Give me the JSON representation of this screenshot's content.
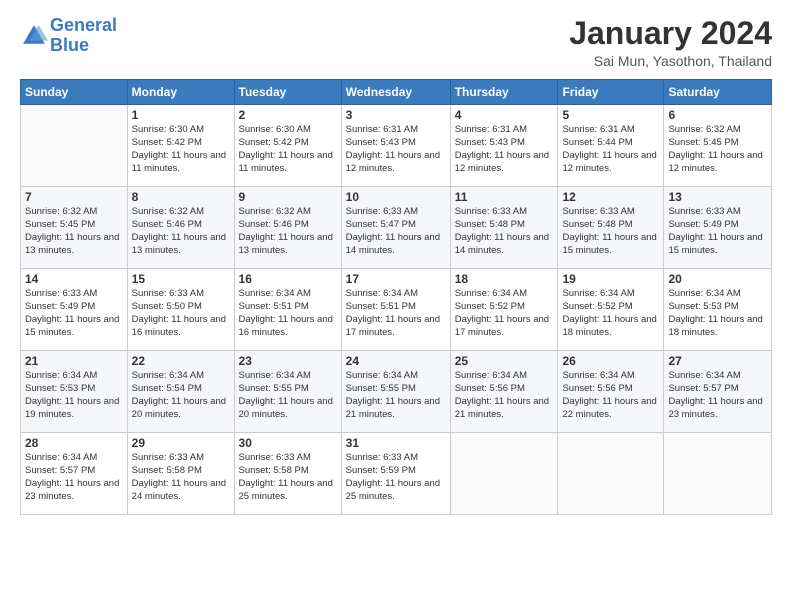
{
  "header": {
    "logo_line1": "General",
    "logo_line2": "Blue",
    "month": "January 2024",
    "location": "Sai Mun, Yasothon, Thailand"
  },
  "days_of_week": [
    "Sunday",
    "Monday",
    "Tuesday",
    "Wednesday",
    "Thursday",
    "Friday",
    "Saturday"
  ],
  "weeks": [
    [
      {
        "day": "",
        "sunrise": "",
        "sunset": "",
        "daylight": ""
      },
      {
        "day": "1",
        "sunrise": "Sunrise: 6:30 AM",
        "sunset": "Sunset: 5:42 PM",
        "daylight": "Daylight: 11 hours and 11 minutes."
      },
      {
        "day": "2",
        "sunrise": "Sunrise: 6:30 AM",
        "sunset": "Sunset: 5:42 PM",
        "daylight": "Daylight: 11 hours and 11 minutes."
      },
      {
        "day": "3",
        "sunrise": "Sunrise: 6:31 AM",
        "sunset": "Sunset: 5:43 PM",
        "daylight": "Daylight: 11 hours and 12 minutes."
      },
      {
        "day": "4",
        "sunrise": "Sunrise: 6:31 AM",
        "sunset": "Sunset: 5:43 PM",
        "daylight": "Daylight: 11 hours and 12 minutes."
      },
      {
        "day": "5",
        "sunrise": "Sunrise: 6:31 AM",
        "sunset": "Sunset: 5:44 PM",
        "daylight": "Daylight: 11 hours and 12 minutes."
      },
      {
        "day": "6",
        "sunrise": "Sunrise: 6:32 AM",
        "sunset": "Sunset: 5:45 PM",
        "daylight": "Daylight: 11 hours and 12 minutes."
      }
    ],
    [
      {
        "day": "7",
        "sunrise": "Sunrise: 6:32 AM",
        "sunset": "Sunset: 5:45 PM",
        "daylight": "Daylight: 11 hours and 13 minutes."
      },
      {
        "day": "8",
        "sunrise": "Sunrise: 6:32 AM",
        "sunset": "Sunset: 5:46 PM",
        "daylight": "Daylight: 11 hours and 13 minutes."
      },
      {
        "day": "9",
        "sunrise": "Sunrise: 6:32 AM",
        "sunset": "Sunset: 5:46 PM",
        "daylight": "Daylight: 11 hours and 13 minutes."
      },
      {
        "day": "10",
        "sunrise": "Sunrise: 6:33 AM",
        "sunset": "Sunset: 5:47 PM",
        "daylight": "Daylight: 11 hours and 14 minutes."
      },
      {
        "day": "11",
        "sunrise": "Sunrise: 6:33 AM",
        "sunset": "Sunset: 5:48 PM",
        "daylight": "Daylight: 11 hours and 14 minutes."
      },
      {
        "day": "12",
        "sunrise": "Sunrise: 6:33 AM",
        "sunset": "Sunset: 5:48 PM",
        "daylight": "Daylight: 11 hours and 15 minutes."
      },
      {
        "day": "13",
        "sunrise": "Sunrise: 6:33 AM",
        "sunset": "Sunset: 5:49 PM",
        "daylight": "Daylight: 11 hours and 15 minutes."
      }
    ],
    [
      {
        "day": "14",
        "sunrise": "Sunrise: 6:33 AM",
        "sunset": "Sunset: 5:49 PM",
        "daylight": "Daylight: 11 hours and 15 minutes."
      },
      {
        "day": "15",
        "sunrise": "Sunrise: 6:33 AM",
        "sunset": "Sunset: 5:50 PM",
        "daylight": "Daylight: 11 hours and 16 minutes."
      },
      {
        "day": "16",
        "sunrise": "Sunrise: 6:34 AM",
        "sunset": "Sunset: 5:51 PM",
        "daylight": "Daylight: 11 hours and 16 minutes."
      },
      {
        "day": "17",
        "sunrise": "Sunrise: 6:34 AM",
        "sunset": "Sunset: 5:51 PM",
        "daylight": "Daylight: 11 hours and 17 minutes."
      },
      {
        "day": "18",
        "sunrise": "Sunrise: 6:34 AM",
        "sunset": "Sunset: 5:52 PM",
        "daylight": "Daylight: 11 hours and 17 minutes."
      },
      {
        "day": "19",
        "sunrise": "Sunrise: 6:34 AM",
        "sunset": "Sunset: 5:52 PM",
        "daylight": "Daylight: 11 hours and 18 minutes."
      },
      {
        "day": "20",
        "sunrise": "Sunrise: 6:34 AM",
        "sunset": "Sunset: 5:53 PM",
        "daylight": "Daylight: 11 hours and 18 minutes."
      }
    ],
    [
      {
        "day": "21",
        "sunrise": "Sunrise: 6:34 AM",
        "sunset": "Sunset: 5:53 PM",
        "daylight": "Daylight: 11 hours and 19 minutes."
      },
      {
        "day": "22",
        "sunrise": "Sunrise: 6:34 AM",
        "sunset": "Sunset: 5:54 PM",
        "daylight": "Daylight: 11 hours and 20 minutes."
      },
      {
        "day": "23",
        "sunrise": "Sunrise: 6:34 AM",
        "sunset": "Sunset: 5:55 PM",
        "daylight": "Daylight: 11 hours and 20 minutes."
      },
      {
        "day": "24",
        "sunrise": "Sunrise: 6:34 AM",
        "sunset": "Sunset: 5:55 PM",
        "daylight": "Daylight: 11 hours and 21 minutes."
      },
      {
        "day": "25",
        "sunrise": "Sunrise: 6:34 AM",
        "sunset": "Sunset: 5:56 PM",
        "daylight": "Daylight: 11 hours and 21 minutes."
      },
      {
        "day": "26",
        "sunrise": "Sunrise: 6:34 AM",
        "sunset": "Sunset: 5:56 PM",
        "daylight": "Daylight: 11 hours and 22 minutes."
      },
      {
        "day": "27",
        "sunrise": "Sunrise: 6:34 AM",
        "sunset": "Sunset: 5:57 PM",
        "daylight": "Daylight: 11 hours and 23 minutes."
      }
    ],
    [
      {
        "day": "28",
        "sunrise": "Sunrise: 6:34 AM",
        "sunset": "Sunset: 5:57 PM",
        "daylight": "Daylight: 11 hours and 23 minutes."
      },
      {
        "day": "29",
        "sunrise": "Sunrise: 6:33 AM",
        "sunset": "Sunset: 5:58 PM",
        "daylight": "Daylight: 11 hours and 24 minutes."
      },
      {
        "day": "30",
        "sunrise": "Sunrise: 6:33 AM",
        "sunset": "Sunset: 5:58 PM",
        "daylight": "Daylight: 11 hours and 25 minutes."
      },
      {
        "day": "31",
        "sunrise": "Sunrise: 6:33 AM",
        "sunset": "Sunset: 5:59 PM",
        "daylight": "Daylight: 11 hours and 25 minutes."
      },
      {
        "day": "",
        "sunrise": "",
        "sunset": "",
        "daylight": ""
      },
      {
        "day": "",
        "sunrise": "",
        "sunset": "",
        "daylight": ""
      },
      {
        "day": "",
        "sunrise": "",
        "sunset": "",
        "daylight": ""
      }
    ]
  ]
}
